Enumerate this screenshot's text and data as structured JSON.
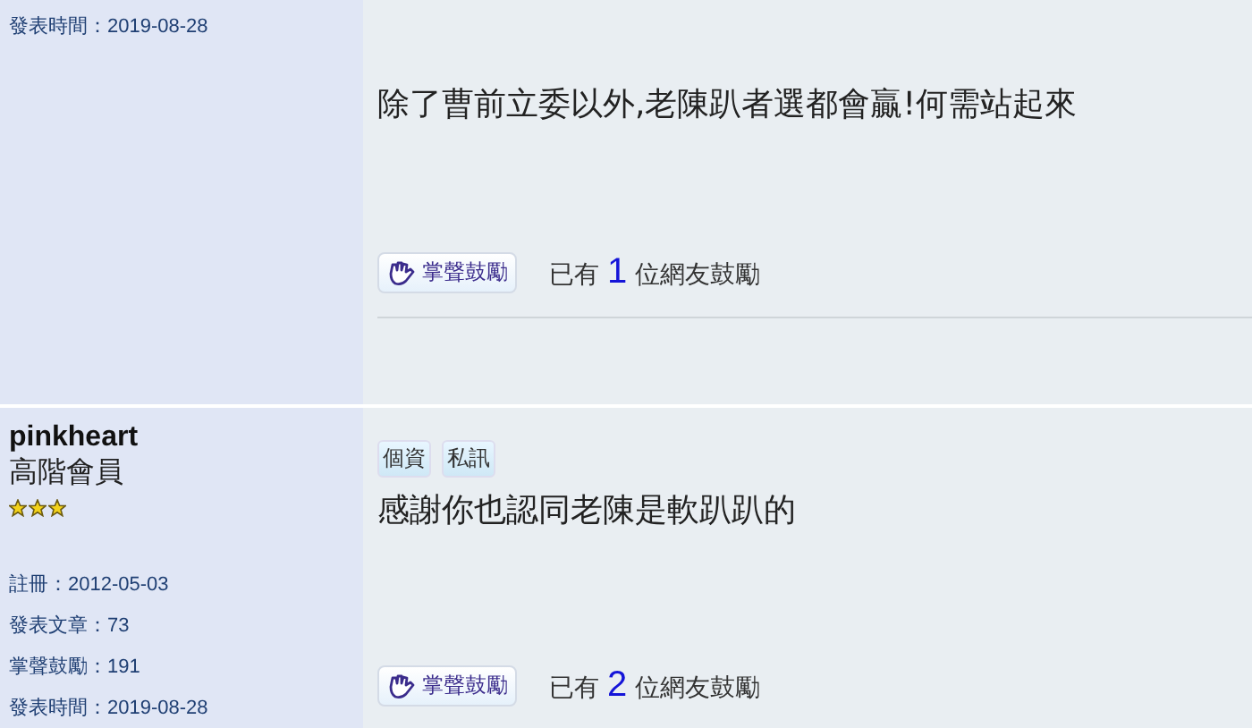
{
  "posts": [
    {
      "author": {
        "stats": [
          "發表時間：2019-08-28"
        ]
      },
      "content": "除了曹前立委以外,老陳趴者選都會贏!何需站起來",
      "kudos_button": "掌聲鼓勵",
      "kudos": {
        "prefix": "已有",
        "count": "1",
        "suffix": "位網友鼓勵"
      }
    },
    {
      "author": {
        "name": "pinkheart",
        "rank": "高階會員",
        "stars": 3,
        "stats": [
          "註冊：2012-05-03",
          "發表文章：73",
          "掌聲鼓勵：191",
          "發表時間：2019-08-28"
        ]
      },
      "actions": [
        "個資",
        "私訊"
      ],
      "content": "感謝你也認同老陳是軟趴趴的",
      "kudos_button": "掌聲鼓勵",
      "kudos": {
        "prefix": "已有",
        "count": "2",
        "suffix": "位網友鼓勵"
      }
    }
  ]
}
